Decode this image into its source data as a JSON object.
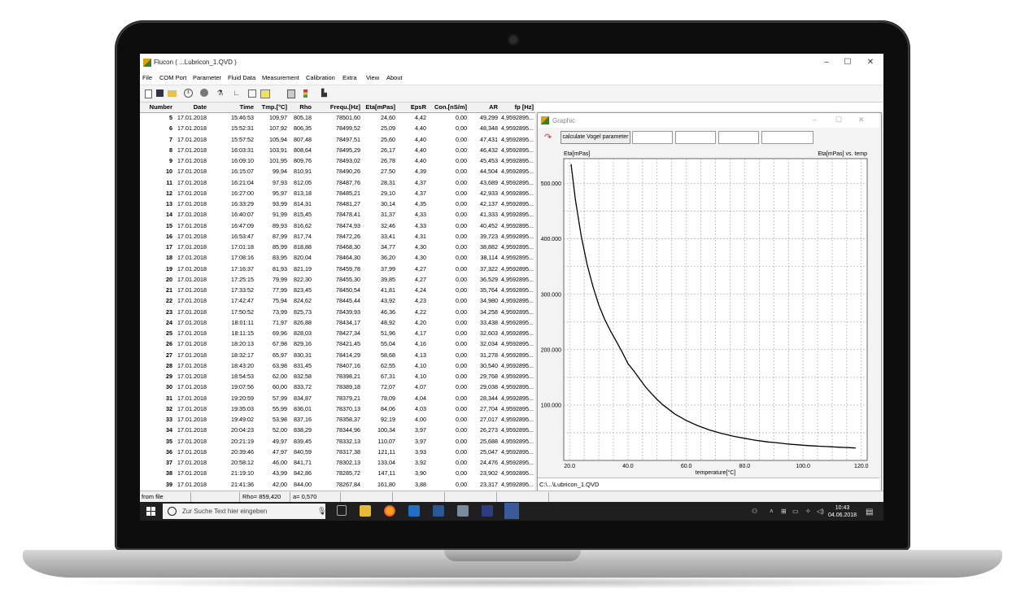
{
  "window": {
    "title": "Flucon ( ...Lubricon_1.QVD )",
    "min": "–",
    "max": "☐",
    "close": "✕"
  },
  "menu": [
    "File",
    "COM Port",
    "Parameter",
    "Fluid Data",
    "Measurement",
    "Calibration",
    "Extra",
    "View",
    "About"
  ],
  "toolbar_icons": [
    "new-file-icon",
    "save-icon",
    "open-folder-icon",
    "pause-icon",
    "record-icon",
    "probe-icon",
    "angle-icon",
    "chart-icon",
    "table-icon",
    "calculator-icon",
    "traffic-light-icon",
    "bar-chart-icon"
  ],
  "table": {
    "headers": [
      "Number",
      "Date",
      "Time",
      "Tmp.[°C]",
      "Rho",
      "Frequ.[Hz]",
      "Eta[mPas]",
      "EpsR",
      "Con.[nS/m]",
      "AR",
      "fp [Hz]"
    ],
    "rows": [
      [
        "5",
        "17.01.2018",
        "15:46:53",
        "109,97",
        "805,18",
        "78501,60",
        "24,60",
        "4,42",
        "0,00",
        "49,299",
        "4,9592895..."
      ],
      [
        "6",
        "17.01.2018",
        "15:52:31",
        "107,92",
        "806,35",
        "78499,52",
        "25,09",
        "4,40",
        "0,00",
        "48,348",
        "4,9592895..."
      ],
      [
        "7",
        "17.01.2018",
        "15:57:52",
        "105,94",
        "807,48",
        "78497,51",
        "25,60",
        "4,40",
        "0,00",
        "47,431",
        "4,9592895..."
      ],
      [
        "8",
        "17.01.2018",
        "16:03:31",
        "103,91",
        "808,64",
        "78495,29",
        "26,17",
        "4,40",
        "0,00",
        "46,432",
        "4,9592895..."
      ],
      [
        "9",
        "17.01.2018",
        "16:09:10",
        "101,95",
        "809,76",
        "78493,02",
        "26,78",
        "4,40",
        "0,00",
        "45,453",
        "4,9592895..."
      ],
      [
        "10",
        "17.01.2018",
        "16:15:07",
        "99,94",
        "810,91",
        "78490,26",
        "27,50",
        "4,39",
        "0,00",
        "44,504",
        "4,9592895..."
      ],
      [
        "11",
        "17.01.2018",
        "16:21:04",
        "97,93",
        "812,05",
        "78487,76",
        "28,31",
        "4,37",
        "0,00",
        "43,689",
        "4,9592895..."
      ],
      [
        "12",
        "17.01.2018",
        "16:27:00",
        "95,97",
        "813,18",
        "78485,21",
        "29,10",
        "4,37",
        "0,00",
        "42,933",
        "4,9592895..."
      ],
      [
        "13",
        "17.01.2018",
        "16:33:29",
        "93,99",
        "814,31",
        "78481,27",
        "30,14",
        "4,35",
        "0,00",
        "42,137",
        "4,9592895..."
      ],
      [
        "14",
        "17.01.2018",
        "16:40:07",
        "91,99",
        "815,45",
        "78478,41",
        "31,37",
        "4,33",
        "0,00",
        "41,333",
        "4,9592895..."
      ],
      [
        "15",
        "17.01.2018",
        "16:47:09",
        "89,93",
        "816,62",
        "78474,93",
        "32,46",
        "4,33",
        "0,00",
        "40,452",
        "4,9592895..."
      ],
      [
        "16",
        "17.01.2018",
        "16:53:47",
        "87,99",
        "817,74",
        "78472,26",
        "33,41",
        "4,31",
        "0,00",
        "39,723",
        "4,9592895..."
      ],
      [
        "17",
        "17.01.2018",
        "17:01:18",
        "85,99",
        "818,88",
        "78468,30",
        "34,77",
        "4,30",
        "0,00",
        "38,882",
        "4,9592895..."
      ],
      [
        "18",
        "17.01.2018",
        "17:08:16",
        "83,95",
        "820,04",
        "78464,30",
        "36,20",
        "4,30",
        "0,00",
        "38,114",
        "4,9592895..."
      ],
      [
        "19",
        "17.01.2018",
        "17:16:37",
        "81,93",
        "821,19",
        "78459,78",
        "37,99",
        "4,27",
        "0,00",
        "37,322",
        "4,9592895..."
      ],
      [
        "20",
        "17.01.2018",
        "17:25:15",
        "79,99",
        "822,30",
        "78455,30",
        "39,85",
        "4,27",
        "0,00",
        "36,529",
        "4,9592895..."
      ],
      [
        "21",
        "17.01.2018",
        "17:33:52",
        "77,99",
        "823,45",
        "78450,54",
        "41,81",
        "4,24",
        "0,00",
        "35,764",
        "4,9592895..."
      ],
      [
        "22",
        "17.01.2018",
        "17:42:47",
        "75,94",
        "824,62",
        "78445,44",
        "43,92",
        "4,23",
        "0,00",
        "34,980",
        "4,9592895..."
      ],
      [
        "23",
        "17.01.2018",
        "17:50:52",
        "73,99",
        "825,73",
        "78439,93",
        "46,36",
        "4,22",
        "0,00",
        "34,258",
        "4,9592895..."
      ],
      [
        "24",
        "17.01.2018",
        "18:01:11",
        "71,97",
        "826,88",
        "78434,17",
        "48,92",
        "4,20",
        "0,00",
        "33,438",
        "4,9592895..."
      ],
      [
        "25",
        "17.01.2018",
        "18:11:15",
        "69,96",
        "828,03",
        "78427,34",
        "51,96",
        "4,17",
        "0,00",
        "32,603",
        "4,9592895..."
      ],
      [
        "26",
        "17.01.2018",
        "18:20:13",
        "67,98",
        "829,16",
        "78421,45",
        "55,04",
        "4,16",
        "0,00",
        "32,034",
        "4,9592895..."
      ],
      [
        "27",
        "17.01.2018",
        "18:32:17",
        "65,97",
        "830,31",
        "78414,29",
        "58,68",
        "4,13",
        "0,00",
        "31,278",
        "4,9592895..."
      ],
      [
        "28",
        "17.01.2018",
        "18:43:20",
        "63,98",
        "831,45",
        "78407,16",
        "62,55",
        "4,10",
        "0,00",
        "30,540",
        "4,9592895..."
      ],
      [
        "29",
        "17.01.2018",
        "18:54:53",
        "62,00",
        "832,58",
        "78398,21",
        "67,31",
        "4,10",
        "0,00",
        "29,768",
        "4,9592895..."
      ],
      [
        "30",
        "17.01.2018",
        "19:07:56",
        "60,00",
        "833,72",
        "78389,18",
        "72,07",
        "4,07",
        "0,00",
        "29,038",
        "4,9592895..."
      ],
      [
        "31",
        "17.01.2018",
        "19:20:59",
        "57,99",
        "834,87",
        "78379,21",
        "78,09",
        "4,04",
        "0,00",
        "28,344",
        "4,9592895..."
      ],
      [
        "32",
        "17.01.2018",
        "19:35:03",
        "55,99",
        "836,01",
        "78370,13",
        "84,06",
        "4,03",
        "0,00",
        "27,704",
        "4,9592895..."
      ],
      [
        "33",
        "17.01.2018",
        "19:49:02",
        "53,98",
        "837,16",
        "78358,37",
        "92,19",
        "4,00",
        "0,00",
        "27,017",
        "4,9592895..."
      ],
      [
        "34",
        "17.01.2018",
        "20:04:23",
        "52,00",
        "838,29",
        "78344,96",
        "100,34",
        "3,97",
        "0,00",
        "26,273",
        "4,9592895..."
      ],
      [
        "35",
        "17.01.2018",
        "20:21:19",
        "49,97",
        "839,45",
        "78332,13",
        "110,07",
        "3,97",
        "0,00",
        "25,688",
        "4,9592895..."
      ],
      [
        "36",
        "17.01.2018",
        "20:39:46",
        "47,97",
        "840,59",
        "78317,38",
        "121,11",
        "3,93",
        "0,00",
        "25,047",
        "4,9592895..."
      ],
      [
        "37",
        "17.01.2018",
        "20:58:12",
        "46,00",
        "841,71",
        "78302,13",
        "133,04",
        "3,92",
        "0,00",
        "24,476",
        "4,9592895..."
      ],
      [
        "38",
        "17.01.2018",
        "21:19:10",
        "43,99",
        "842,86",
        "78285,72",
        "147,11",
        "3,90",
        "0,00",
        "23,902",
        "4,9592895..."
      ],
      [
        "39",
        "17.01.2018",
        "21:41:36",
        "42,00",
        "844,00",
        "78267,84",
        "161,80",
        "3,88",
        "0,00",
        "23,317",
        "4,9592895..."
      ]
    ]
  },
  "graphic": {
    "title": "Graphic",
    "calc_button": "calculate Vogel parameter",
    "status_path": "C:\\...\\Lubricon_1.QVD"
  },
  "chart_data": {
    "type": "line",
    "title": "Eta[mPas] vs. temp",
    "ylabel": "Eta[mPas]",
    "xlabel": "temperature[°C]",
    "xlim": [
      18,
      122
    ],
    "ylim": [
      0,
      545
    ],
    "x_ticks": [
      "20.0",
      "40.0",
      "60.0",
      "80.0",
      "100.0",
      "120.0"
    ],
    "y_ticks": [
      "100.000",
      "200.000",
      "300.000",
      "400.000",
      "500.000"
    ],
    "grid": true,
    "series": [
      {
        "x": [
          20.5,
          22,
          24,
          26,
          28,
          30,
          32,
          34,
          36,
          38,
          40,
          42,
          44,
          46,
          48,
          50,
          52,
          54,
          56,
          58,
          60,
          62,
          64,
          66,
          68,
          70,
          72,
          74,
          76,
          78,
          80,
          82,
          84,
          86,
          88,
          90,
          92,
          94,
          96,
          98,
          100,
          102,
          104,
          106,
          108,
          110,
          112,
          114,
          116,
          118
        ],
        "values": [
          535,
          471,
          405,
          354,
          314,
          281,
          255,
          234,
          215,
          196,
          175,
          161.8,
          147.1,
          133,
          121.1,
          110.1,
          100.3,
          92.2,
          84.1,
          78.1,
          72.1,
          67.3,
          62.6,
          58.7,
          55,
          52,
          48.9,
          46.4,
          43.9,
          41.8,
          39.9,
          38,
          36.2,
          34.8,
          33.4,
          32.5,
          31.4,
          30.1,
          29.1,
          28.3,
          27.5,
          26.8,
          26.2,
          25.6,
          25.1,
          24.6,
          24,
          23.5,
          23,
          22.5
        ]
      }
    ]
  },
  "statusbar": {
    "source": "from file",
    "rho": "Rho= 859,420",
    "a": "a= 0,570"
  },
  "taskbar": {
    "search_placeholder": "Zur Suche Text hier eingeben",
    "time": "10:43",
    "date": "04.06.2018"
  },
  "colors": {
    "taskbar": "#1f1f1f",
    "plot_line": "#000000",
    "grid": "#a0a0a0"
  }
}
